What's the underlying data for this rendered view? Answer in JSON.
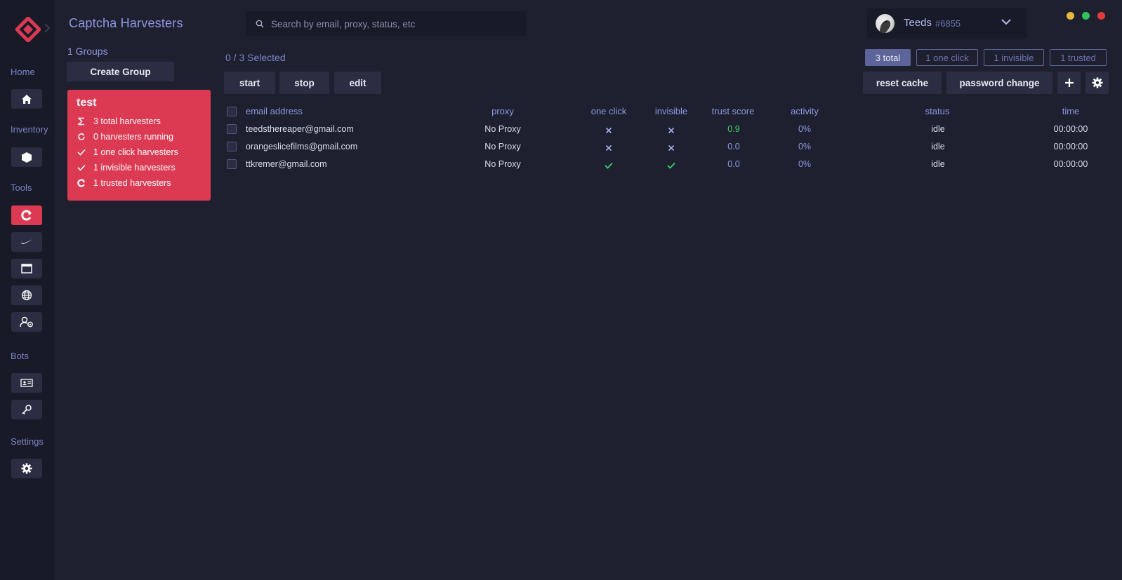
{
  "sidebar": {
    "sections": [
      {
        "label": "Home",
        "items": [
          {
            "icon": "home-icon"
          }
        ]
      },
      {
        "label": "Inventory",
        "items": [
          {
            "icon": "box-icon"
          }
        ]
      },
      {
        "label": "Tools",
        "items": [
          {
            "icon": "captcha-icon"
          },
          {
            "icon": "nike-icon"
          },
          {
            "icon": "browser-window-icon"
          },
          {
            "icon": "globe-icon"
          },
          {
            "icon": "user-settings-icon"
          }
        ]
      },
      {
        "label": "Bots",
        "items": [
          {
            "icon": "id-card-icon"
          },
          {
            "icon": "key-icon"
          }
        ]
      },
      {
        "label": "Settings",
        "items": [
          {
            "icon": "gear-icon"
          }
        ]
      }
    ]
  },
  "header": {
    "title": "Captcha Harvesters",
    "search_placeholder": "Search by email, proxy, status, etc",
    "user": {
      "name": "Teeds",
      "tag": "#6855"
    }
  },
  "groups": {
    "count_label": "1 Groups",
    "create_label": "Create Group",
    "items": [
      {
        "name": "test",
        "stats": [
          {
            "icon": "sigma-icon",
            "text": "3 total harvesters"
          },
          {
            "icon": "refresh-icon",
            "text": "0 harvesters running"
          },
          {
            "icon": "check-icon",
            "text": "1 one click harvesters"
          },
          {
            "icon": "check-icon",
            "text": "1 invisible harvesters"
          },
          {
            "icon": "captcha-icon",
            "text": "1 trusted harvesters"
          }
        ]
      }
    ]
  },
  "main": {
    "selected_label": "0 / 3 Selected",
    "actions": {
      "start": "start",
      "stop": "stop",
      "edit": "edit",
      "reset_cache": "reset cache",
      "password_change": "password change"
    },
    "filters": [
      {
        "label": "3 total",
        "active": true
      },
      {
        "label": "1 one click",
        "active": false
      },
      {
        "label": "1 invisible",
        "active": false
      },
      {
        "label": "1 trusted",
        "active": false
      }
    ],
    "columns": {
      "email": "email address",
      "proxy": "proxy",
      "one_click": "one click",
      "invisible": "invisible",
      "trust_score": "trust score",
      "activity": "activity",
      "status": "status",
      "time": "time"
    },
    "rows": [
      {
        "email": "teedsthereaper@gmail.com",
        "proxy": "No Proxy",
        "one_click": false,
        "invisible": false,
        "trust_score": "0.9",
        "activity": "0%",
        "status": "idle",
        "time": "00:00:00"
      },
      {
        "email": "orangeslicefilms@gmail.com",
        "proxy": "No Proxy",
        "one_click": false,
        "invisible": false,
        "trust_score": "0.0",
        "activity": "0%",
        "status": "idle",
        "time": "00:00:00"
      },
      {
        "email": "ttkremer@gmail.com",
        "proxy": "No Proxy",
        "one_click": true,
        "invisible": true,
        "trust_score": "0.0",
        "activity": "0%",
        "status": "idle",
        "time": "00:00:00"
      }
    ]
  },
  "colors": {
    "accent": "#dc3a52",
    "background": "#1e2030",
    "sidebar": "#181a27",
    "link": "#8e97e0",
    "success": "#3ecf6e"
  }
}
